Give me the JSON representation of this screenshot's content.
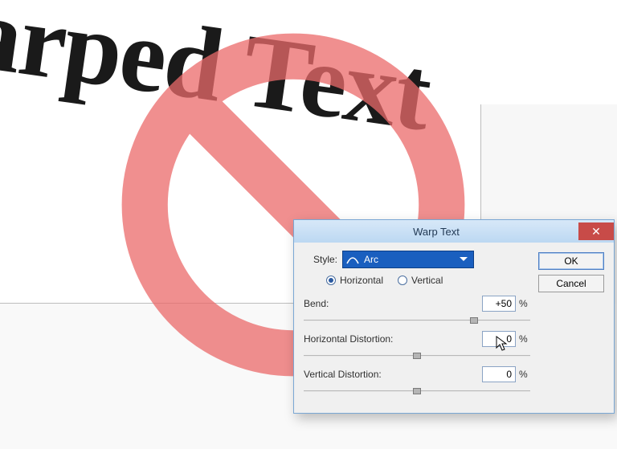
{
  "canvas": {
    "text": "arped Text"
  },
  "dialog": {
    "title": "Warp Text",
    "close_label": "✕",
    "style_label": "Style:",
    "style_value": "Arc",
    "orientation": {
      "horizontal": "Horizontal",
      "vertical": "Vertical",
      "selected": "horizontal"
    },
    "params": {
      "bend": {
        "label": "Bend:",
        "value": "+50",
        "unit": "%",
        "thumb_pct": 75
      },
      "hdist": {
        "label": "Horizontal Distortion:",
        "value": "0",
        "unit": "%",
        "thumb_pct": 50
      },
      "vdist": {
        "label": "Vertical Distortion:",
        "value": "0",
        "unit": "%",
        "thumb_pct": 50
      }
    },
    "buttons": {
      "ok": "OK",
      "cancel": "Cancel"
    }
  },
  "colors": {
    "prohibition": "#EB6A6A",
    "titlebar_top": "#d7e8f8",
    "titlebar_bottom": "#bcd8f2",
    "close": "#c84b48",
    "select_bg": "#1a5fbf"
  }
}
